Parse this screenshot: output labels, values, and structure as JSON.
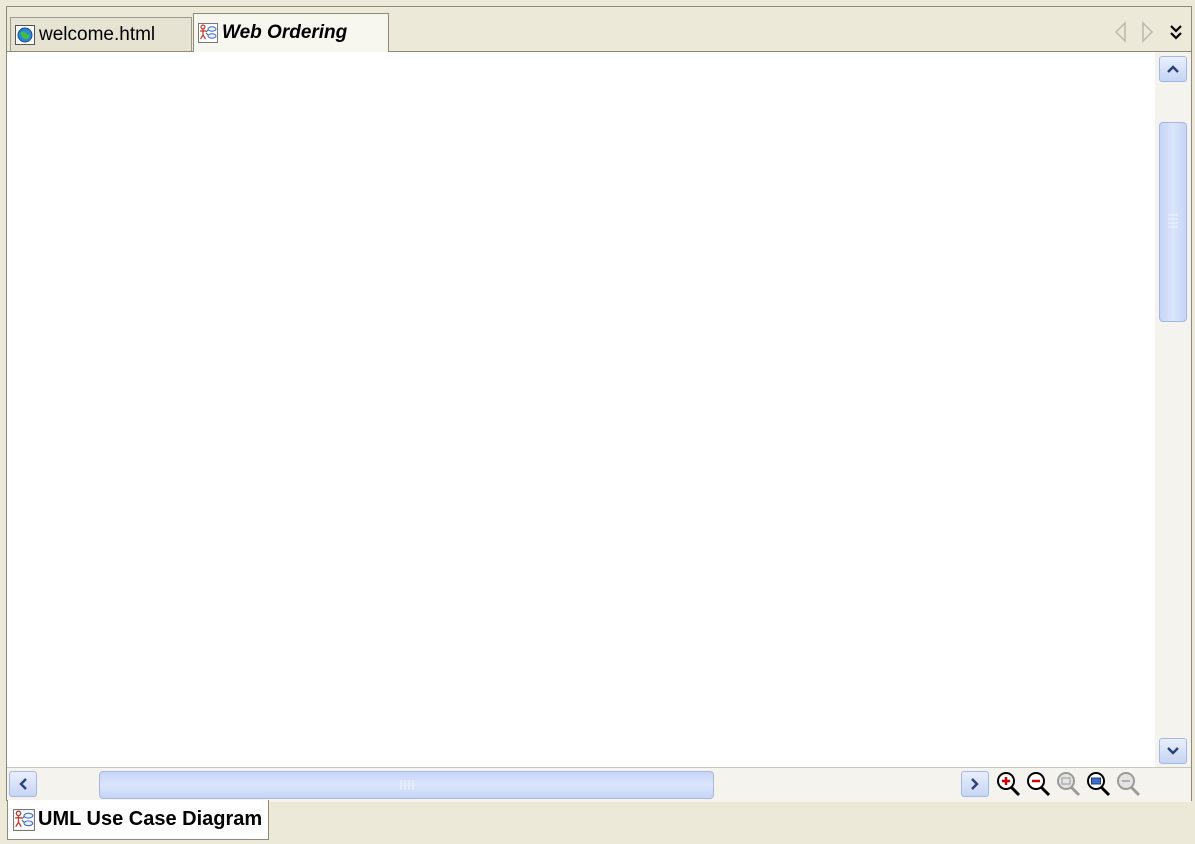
{
  "tabs": [
    {
      "label": "welcome.html",
      "icon": "web-page-icon",
      "active": false
    },
    {
      "label": "Web Ordering",
      "icon": "uml-use-case-diagram-icon",
      "active": true
    }
  ],
  "tab_nav": {
    "previous": "scroll-tabs-left-icon",
    "next": "scroll-tabs-right-icon",
    "more": "show-all-tabs-icon"
  },
  "zoom_tools": [
    {
      "icon": "zoom-in-icon",
      "enabled": true
    },
    {
      "icon": "zoom-out-icon",
      "enabled": true
    },
    {
      "icon": "zoom-actual-size-icon",
      "enabled": false
    },
    {
      "icon": "zoom-to-fit-icon",
      "enabled": true
    },
    {
      "icon": "zoom-reset-icon",
      "enabled": false
    }
  ],
  "view_tab": {
    "label": "UML Use Case Diagram",
    "icon": "uml-use-case-diagram-icon"
  },
  "colors": {
    "window_bg": "#ece9d8",
    "scroll_accent": "#c6d5f7",
    "canvas": "#ffffff"
  }
}
